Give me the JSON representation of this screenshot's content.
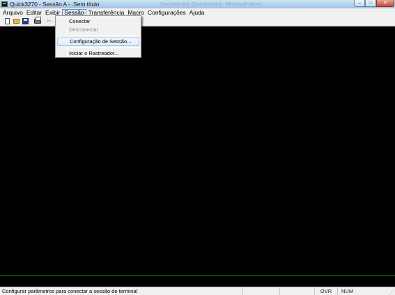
{
  "window": {
    "title": "Quick3270 - Sessão A - .Sem título",
    "background_title_ghost": "Documento1 (Documento) - Microsoft Word",
    "controls": {
      "minimize": "–",
      "maximize": "□",
      "close": "✕"
    }
  },
  "menubar": {
    "items": [
      "Arquivo",
      "Editar",
      "Exibir",
      "Sessão",
      "Transferência",
      "Macro",
      "Configurações",
      "Ajuda"
    ],
    "open_item": "Sessão"
  },
  "session_menu": {
    "items": [
      {
        "label": "Conectar",
        "enabled": true
      },
      {
        "label": "Desconectar",
        "enabled": false
      },
      {
        "label": "Configuração de Sessão...",
        "enabled": true,
        "highlighted": true
      },
      {
        "label": "Iniciar o Rastreador...",
        "enabled": true
      }
    ]
  },
  "toolbar": {
    "icons": [
      "new-document-icon",
      "open-folder-icon",
      "save-disk-icon",
      "print-icon",
      "cut-scissors-icon"
    ],
    "cut_glyph": "✂"
  },
  "statusbar": {
    "message": "Configurar parâmetros para conectar a sessão de terminal",
    "overwrite": "OVR",
    "numlock": "NUM"
  },
  "colors": {
    "terminal_background": "#000000",
    "oia_line": "#1f8a1f",
    "menu_highlight": "#deebfa"
  }
}
